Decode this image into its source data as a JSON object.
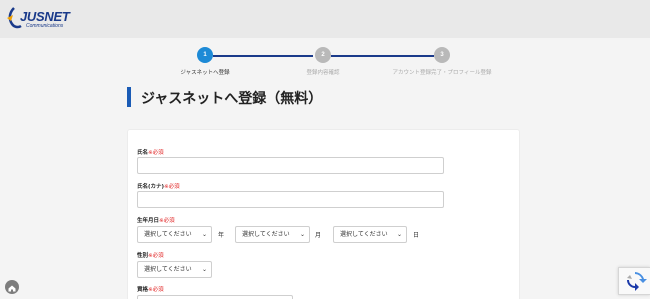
{
  "header": {
    "logo_text": "JUSNET",
    "logo_sub": "Communications"
  },
  "steps": [
    {
      "num": "1",
      "label": "ジャスネットへ登録"
    },
    {
      "num": "2",
      "label": "登録内容確認"
    },
    {
      "num": "3",
      "label": "アカウント登録完了・プロフィール登録"
    }
  ],
  "page_title": "ジャスネットへ登録（無料）",
  "form": {
    "required_mark": "※必須",
    "name_label": "氏名",
    "kana_label": "氏名(カナ)",
    "birth_label": "生年月日",
    "select_placeholder": "選択してください",
    "unit_year": "年",
    "unit_month": "月",
    "unit_day": "日",
    "gender_label": "性別",
    "qualification_label": "資格"
  },
  "colors": {
    "accent": "#1a5bb5",
    "step_active": "#1d8ad6",
    "step_inactive": "#b9b9b9",
    "required": "#e02020"
  }
}
